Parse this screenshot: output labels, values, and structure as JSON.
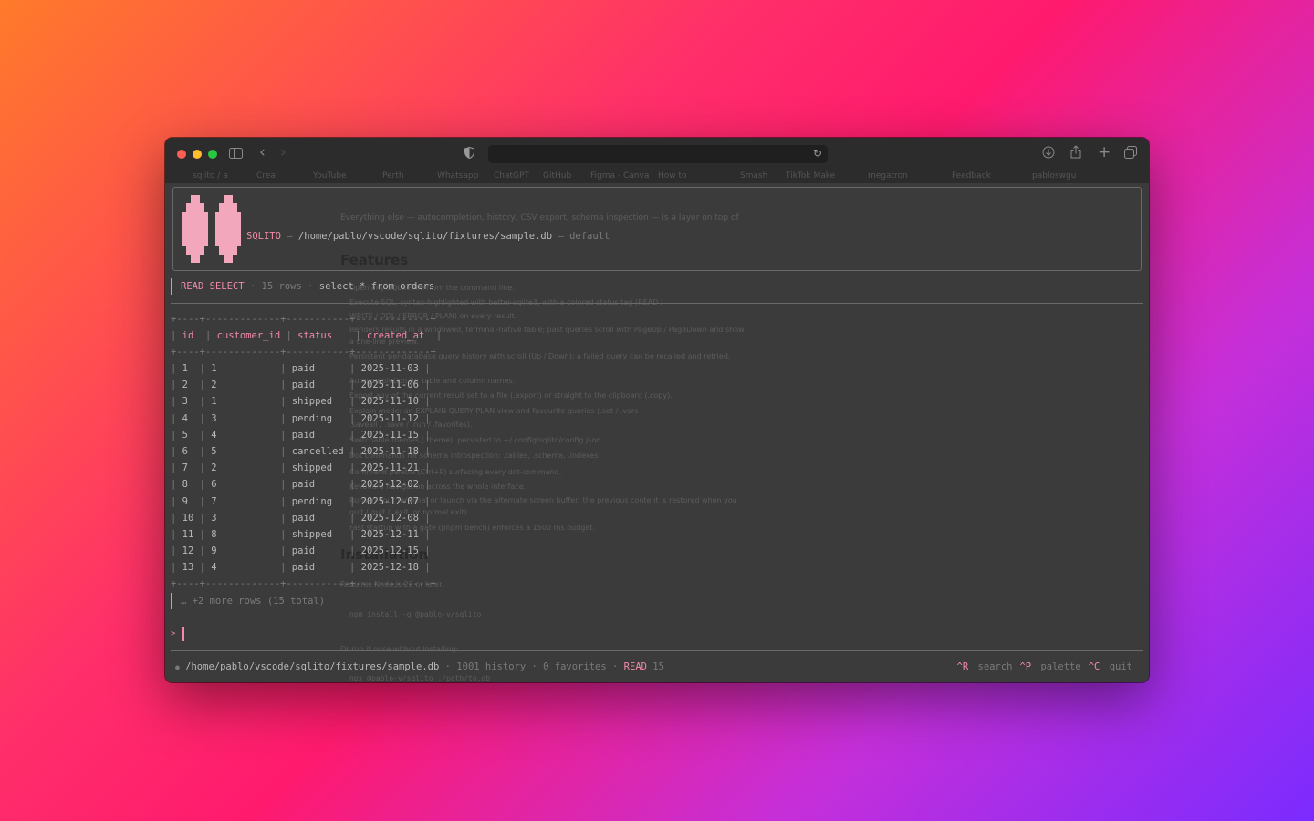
{
  "browser": {
    "bookmarks": [
      "sqlito / a",
      "Crea",
      "YouTube",
      "Perth",
      "Whatsapp",
      "ChatGPT",
      "GitHub",
      "Figma - Canva",
      "How to",
      "Smash",
      "TikTok Make",
      "megatron",
      "Feedback",
      "pabloswgu"
    ]
  },
  "background_doc": {
    "intro": "Everything else — autocompletion, history, CSV export, schema inspection — is a layer on top of",
    "features_heading": "Features",
    "installation_heading": "Installation",
    "lines": [
      "Open any SQLite file from the command line.",
      "Execute SQL, syntax-highlighted with better-sqlite3, with a colored status tag (READ /",
      "WRITE / DDL / ERROR / PLAN) on every result.",
      "Renders results in a windowed, terminal-native table; past queries scroll with PageUp / PageDown and show",
      "a one-line preview.",
      "Persistent per-database query history with scroll (Up / Down); a failed query can be recalled and retried.",
      "Autocompletion for table and column names.",
      "Export any of the current result set to a file (.export) or straight to the clipboard (.copy).",
      "Explain mode: an EXPLAIN QUERY PLAN view and favourite queries (.set / .vars",
      ".saveall / .save / .run / .favorites).",
      "Switchable themes (.theme), persisted to ~/.config/sqlito/config.json",
      "Dot commands for schema introspection: .tables, .schema, .indexes",
      "Command palette (Ctrl+P) surfacing every dot-command.",
      "Keyboard navigation across the whole interface.",
      "Runs in your terminal or launch via the alternate screen buffer; the previous content is restored when you",
      "quit (.quit / .exit, or normal exit).",
      "Fast startup with a gate (pnpm bench) enforces a 1500 ms budget.",
      "Requires Node.js 22 or later.",
      "npm install -g @pablo-v/sqlito",
      "Or run it once without installing:",
      "npx @pablo-v/sqlito ./path/to.db"
    ]
  },
  "header": {
    "app_name": "SQLITO",
    "separator": "—",
    "db_path": "/home/pablo/vscode/sqlito/fixtures/sample.db",
    "profile": "default"
  },
  "result": {
    "tag": "READ",
    "kind": "SELECT",
    "rows_label": "15 rows",
    "query": "select * from orders",
    "border_top": "+----+-------------+-----------+-------------+",
    "columns": [
      "id",
      "customer_id",
      "status",
      "created_at"
    ],
    "rows": [
      [
        "1",
        "1",
        "paid",
        "2025-11-03"
      ],
      [
        "2",
        "2",
        "paid",
        "2025-11-06"
      ],
      [
        "3",
        "1",
        "shipped",
        "2025-11-10"
      ],
      [
        "4",
        "3",
        "pending",
        "2025-11-12"
      ],
      [
        "5",
        "4",
        "paid",
        "2025-11-15"
      ],
      [
        "6",
        "5",
        "cancelled",
        "2025-11-18"
      ],
      [
        "7",
        "2",
        "shipped",
        "2025-11-21"
      ],
      [
        "8",
        "6",
        "paid",
        "2025-12-02"
      ],
      [
        "9",
        "7",
        "pending",
        "2025-12-07"
      ],
      [
        "10",
        "3",
        "paid",
        "2025-12-08"
      ],
      [
        "11",
        "8",
        "shipped",
        "2025-12-11"
      ],
      [
        "12",
        "9",
        "paid",
        "2025-12-15"
      ],
      [
        "13",
        "4",
        "paid",
        "2025-12-18"
      ]
    ],
    "more_rows": "… +2 more rows (15 total)"
  },
  "prompt": {
    "symbol": ">"
  },
  "footer": {
    "dot": "●",
    "db_path": "/home/pablo/vscode/sqlito/fixtures/sample.db",
    "history": "1001 history",
    "favorites": "0 favorites",
    "status_tag": "READ",
    "status_count": "15",
    "keys": [
      {
        "key": "^R",
        "label": "search"
      },
      {
        "key": "^P",
        "label": "palette"
      },
      {
        "key": "^C",
        "label": "quit"
      }
    ]
  },
  "colors": {
    "accent": "#f28aa8",
    "text": "#b8b8b8",
    "dim": "#7a7a7a",
    "panel": "#3b3b3b"
  }
}
